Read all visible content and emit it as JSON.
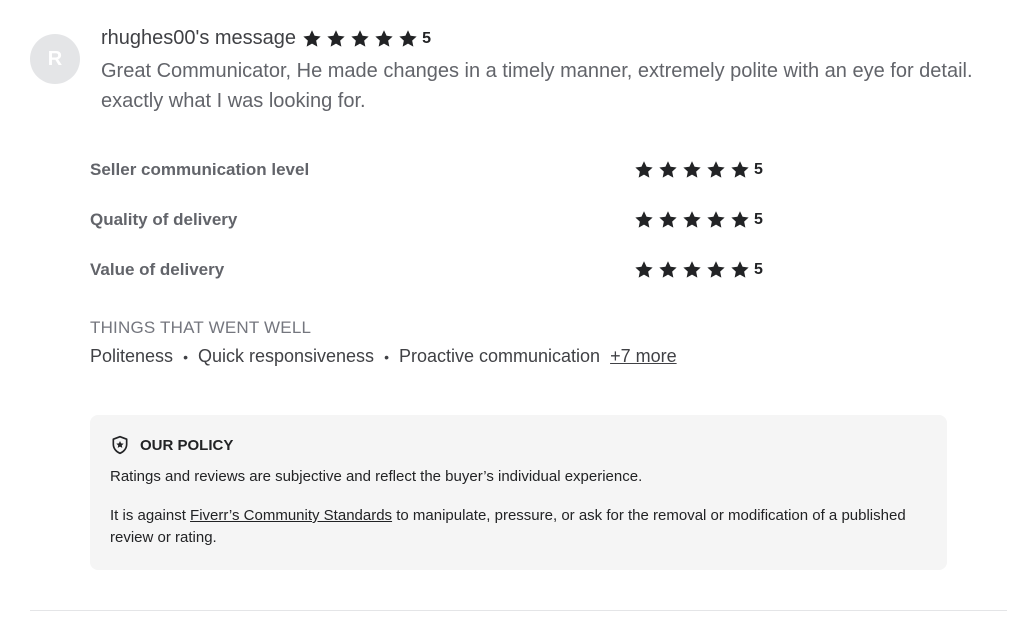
{
  "review": {
    "avatar_initial": "R",
    "username": "rhughes00's message",
    "rating": "5",
    "message": "Great Communicator, He made changes in a timely manner, extremely polite with an eye for detail. exactly what I was looking for.",
    "star_icon": "star-icon",
    "star_color": "#222325"
  },
  "ratings": [
    {
      "label": "Seller communication level",
      "score": "5"
    },
    {
      "label": "Quality of delivery",
      "score": "5"
    },
    {
      "label": "Value of delivery",
      "score": "5"
    }
  ],
  "went_well": {
    "title": "THINGS THAT WENT WELL",
    "tags": [
      "Politeness",
      "Quick responsiveness",
      "Proactive communication"
    ],
    "separator": "•",
    "more_label": "+7 more"
  },
  "policy": {
    "icon": "shield-star-icon",
    "title": "OUR POLICY",
    "text1": "Ratings and reviews are subjective and reflect the buyer’s individual experience.",
    "text2_before": "It is against ",
    "text2_link": "Fiverr’s Community Standards",
    "text2_after": " to manipulate, pressure, or ask for the removal or modification of a published review or rating."
  }
}
